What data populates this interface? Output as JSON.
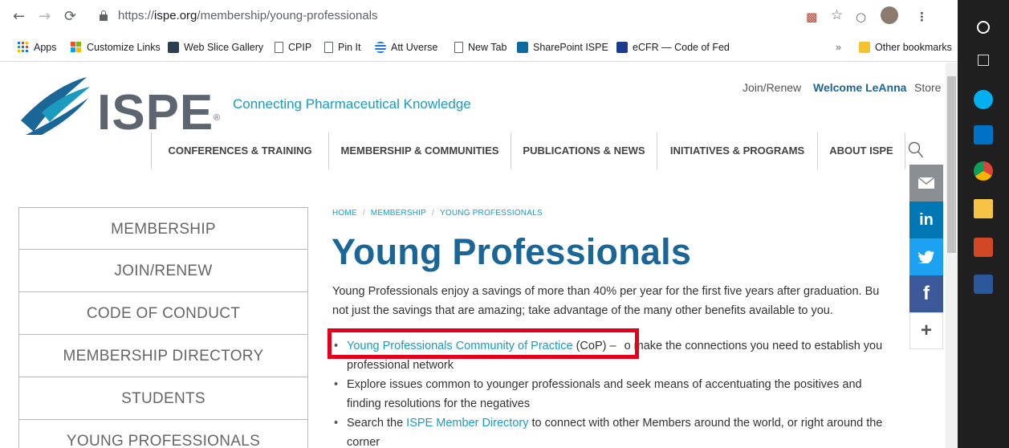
{
  "browser": {
    "url_prefix": "https://",
    "url_host": "ispe.org",
    "url_path": "/membership/young-professionals"
  },
  "bookmarks": [
    {
      "label": "Apps",
      "icon": "apps-grid-icon"
    },
    {
      "label": "Customize Links",
      "icon": "windows-logo-icon"
    },
    {
      "label": "Web Slice Gallery",
      "icon": "web-slice-icon"
    },
    {
      "label": "CPIP",
      "icon": "page-icon"
    },
    {
      "label": "Pin It",
      "icon": "page-icon"
    },
    {
      "label": "Att Uverse",
      "icon": "att-globe-icon"
    },
    {
      "label": "New Tab",
      "icon": "page-icon"
    },
    {
      "label": "SharePoint ISPE",
      "icon": "sharepoint-icon"
    },
    {
      "label": "eCFR — Code of Fed",
      "icon": "gpo-icon"
    }
  ],
  "bookmarks_overflow": "»",
  "other_bookmarks": "Other bookmarks",
  "site": {
    "logo_text": "ISPE",
    "registered_mark": "®",
    "tagline": "Connecting Pharmaceutical Knowledge",
    "top_links": {
      "join": "Join/Renew",
      "welcome": "Welcome LeAnna",
      "store": "Store"
    },
    "nav": [
      "CONFERENCES & TRAINING",
      "MEMBERSHIP & COMMUNITIES",
      "PUBLICATIONS & NEWS",
      "INITIATIVES & PROGRAMS",
      "ABOUT ISPE"
    ],
    "accent_color": "#1b9bc0",
    "heading_color": "#1a6696"
  },
  "sidebar": {
    "items": [
      "MEMBERSHIP",
      "JOIN/RENEW",
      "CODE OF CONDUCT",
      "MEMBERSHIP DIRECTORY",
      "STUDENTS",
      "YOUNG PROFESSIONALS"
    ]
  },
  "breadcrumb": [
    "HOME",
    "MEMBERSHIP",
    "YOUNG PROFESSIONALS"
  ],
  "content": {
    "title": "Young Professionals",
    "intro": "Young Professionals enjoy a savings of more than 40% per year for the first five years after graduation. Bu",
    "intro_line2": "not just the savings that are amazing; take advantage of the many other benefits available to you.",
    "bullet1_link": "Young Professionals Community of Practice",
    "bullet1_mid": " (CoP) – ",
    "bullet1_rest": "o make the connections you need to establish you",
    "bullet1_line2": "professional network",
    "bullet2": "Explore issues common to younger professionals and seek means of accentuating the positives and",
    "bullet2_line2": "finding resolutions for the negatives",
    "bullet3_pre": "Search the ",
    "bullet3_link": "ISPE Member Directory",
    "bullet3_post": " to connect with other Members around the world, or right around the",
    "bullet3_line2": "corner"
  },
  "share": {
    "linkedin_label": "in",
    "facebook_label": "f",
    "more_label": "+"
  }
}
